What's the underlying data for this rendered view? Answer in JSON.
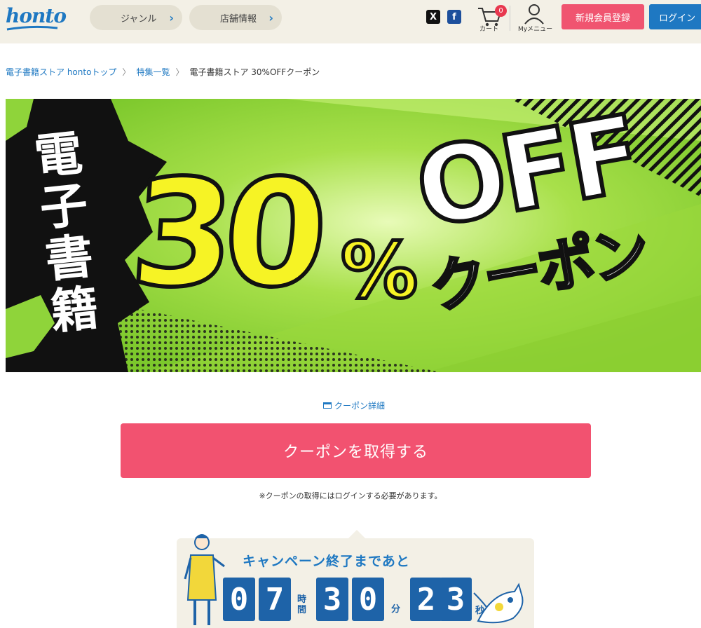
{
  "header": {
    "logo": "honto",
    "nav": [
      {
        "label": "ジャンル"
      },
      {
        "label": "店舗情報"
      }
    ],
    "cart_label": "カート",
    "cart_count": "0",
    "mymenu_label": "Myメニュー",
    "register_label": "新規会員登録",
    "login_label": "ログイン"
  },
  "breadcrumb": {
    "items": [
      "電子書籍ストア hontoトップ",
      "特集一覧"
    ],
    "current": "電子書籍ストア 30%OFFクーポン"
  },
  "banner": {
    "left_text": "電子書籍",
    "big_number": "30",
    "percent": "%",
    "off": "OFF",
    "coupon": "クーポン",
    "colors": {
      "green": "#8fd43a",
      "yellow": "#f6f325",
      "black": "#111111"
    }
  },
  "coupon_detail_label": "クーポン詳細",
  "cta_label": "クーポンを取得する",
  "note": "※クーポンの取得にはログインする必要があります。",
  "countdown": {
    "title": "キャンペーン終了まであと",
    "hours": [
      "0",
      "7"
    ],
    "minutes": [
      "3",
      "0"
    ],
    "seconds": [
      "2",
      "3"
    ],
    "unit_hour": "時間",
    "unit_min": "分",
    "unit_sec": "秒"
  }
}
